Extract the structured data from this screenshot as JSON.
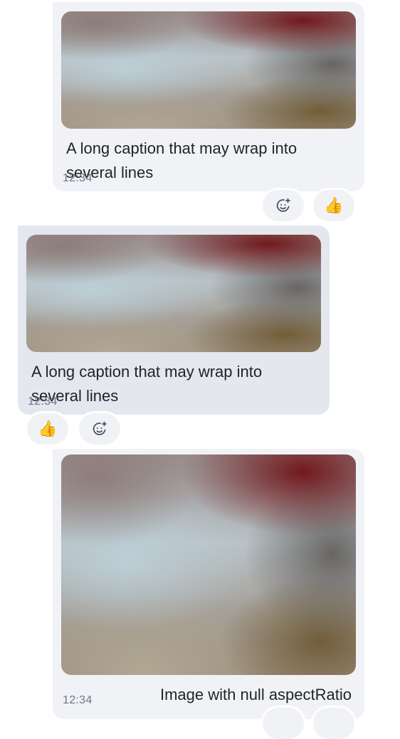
{
  "messages": [
    {
      "direction": "outgoing",
      "caption": "A long caption that may wrap into several lines",
      "time": "12:34",
      "reactions": [
        {
          "icon": "add-reaction-icon",
          "glyph": ""
        },
        {
          "icon": "thumbs-up-icon",
          "glyph": "👍"
        }
      ]
    },
    {
      "direction": "incoming",
      "caption": "A long caption that may wrap into several lines",
      "time": "12:34",
      "reactions": [
        {
          "icon": "thumbs-up-icon",
          "glyph": "👍"
        },
        {
          "icon": "add-reaction-icon",
          "glyph": ""
        }
      ]
    },
    {
      "direction": "outgoing",
      "caption": "Image with null aspectRatio",
      "time": "12:34"
    }
  ],
  "colors": {
    "outgoing_bubble": "#f1f2f6",
    "incoming_bubble": "#e4e7ed",
    "timestamp": "#6d7683",
    "text": "#1f2329"
  }
}
